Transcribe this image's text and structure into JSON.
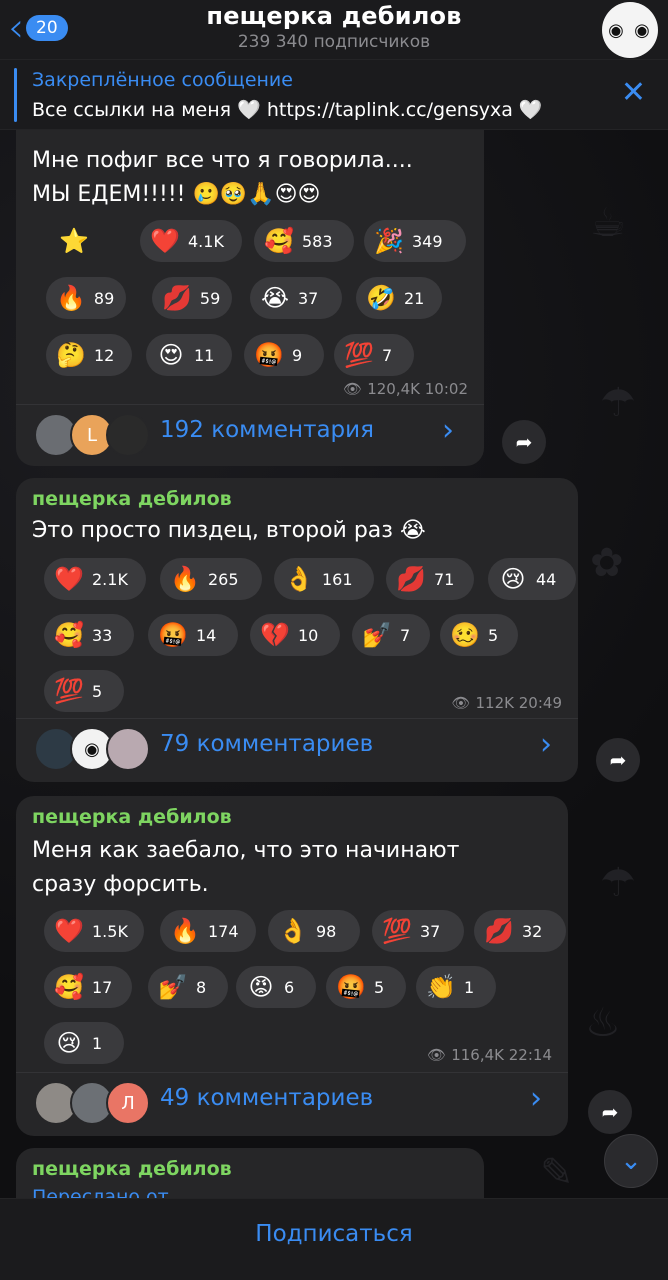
{
  "header": {
    "back_count": "20",
    "title": "пещерка дебилов",
    "subscribers": "239 340 подписчиков",
    "avatar_eyes": "◉ ◉"
  },
  "pinned": {
    "label": "Закреплённое сообщение",
    "text": "Все ссылки на меня 🤍 https://taplink.cc/gensyxa 🤍"
  },
  "messages": [
    {
      "author": "",
      "lines": [
        "Мне пофиг все что я говорила....",
        "МЫ ЕДЕМ!!!!! 🥲🥹🙏😍😍"
      ],
      "reactions": [
        {
          "emoji": "⭐",
          "count": ""
        },
        {
          "emoji": "❤️",
          "count": "4.1K"
        },
        {
          "emoji": "🥰",
          "count": "583"
        },
        {
          "emoji": "🎉",
          "count": "349"
        },
        {
          "emoji": "🔥",
          "count": "89"
        },
        {
          "emoji": "💋",
          "count": "59"
        },
        {
          "emoji": "😭",
          "count": "37"
        },
        {
          "emoji": "🤣",
          "count": "21"
        },
        {
          "emoji": "🤔",
          "count": "12"
        },
        {
          "emoji": "😍",
          "count": "11"
        },
        {
          "emoji": "🤬",
          "count": "9"
        },
        {
          "emoji": "💯",
          "count": "7"
        }
      ],
      "views": "120,4K",
      "time": "10:02",
      "comments": "192 комментария",
      "avatar_letters": [
        "",
        "L",
        ""
      ]
    },
    {
      "author": "пещерка дебилов",
      "lines": [
        "Это просто пиздец, второй раз 😭"
      ],
      "reactions": [
        {
          "emoji": "❤️",
          "count": "2.1K"
        },
        {
          "emoji": "🔥",
          "count": "265"
        },
        {
          "emoji": "👌",
          "count": "161"
        },
        {
          "emoji": "💋",
          "count": "71"
        },
        {
          "emoji": "😢",
          "count": "44"
        },
        {
          "emoji": "🥰",
          "count": "33"
        },
        {
          "emoji": "🤬",
          "count": "14"
        },
        {
          "emoji": "💔",
          "count": "10"
        },
        {
          "emoji": "💅",
          "count": "7"
        },
        {
          "emoji": "🥴",
          "count": "5"
        },
        {
          "emoji": "💯",
          "count": "5"
        }
      ],
      "views": "112K",
      "time": "20:49",
      "comments": "79 комментариев",
      "avatar_letters": [
        "",
        "◉",
        ""
      ]
    },
    {
      "author": "пещерка дебилов",
      "lines": [
        "Меня как заебало, что это начинают",
        "сразу форсить."
      ],
      "reactions": [
        {
          "emoji": "❤️",
          "count": "1.5K"
        },
        {
          "emoji": "🔥",
          "count": "174"
        },
        {
          "emoji": "👌",
          "count": "98"
        },
        {
          "emoji": "💯",
          "count": "37"
        },
        {
          "emoji": "💋",
          "count": "32"
        },
        {
          "emoji": "🥰",
          "count": "17"
        },
        {
          "emoji": "💅",
          "count": "8"
        },
        {
          "emoji": "😡",
          "count": "6"
        },
        {
          "emoji": "🤬",
          "count": "5"
        },
        {
          "emoji": "👏",
          "count": "1"
        },
        {
          "emoji": "😢",
          "count": "1"
        }
      ],
      "views": "116,4K",
      "time": "22:14",
      "comments": "49 комментариев",
      "avatar_letters": [
        "",
        "",
        "Л"
      ]
    },
    {
      "author": "пещерка дебилов",
      "lines": [
        "Переслано от"
      ]
    }
  ],
  "bottom": {
    "subscribe_label": "Подписаться"
  },
  "colors": {
    "accent": "#3a8cf2",
    "author": "#7ed561",
    "bubble": "#262628"
  }
}
